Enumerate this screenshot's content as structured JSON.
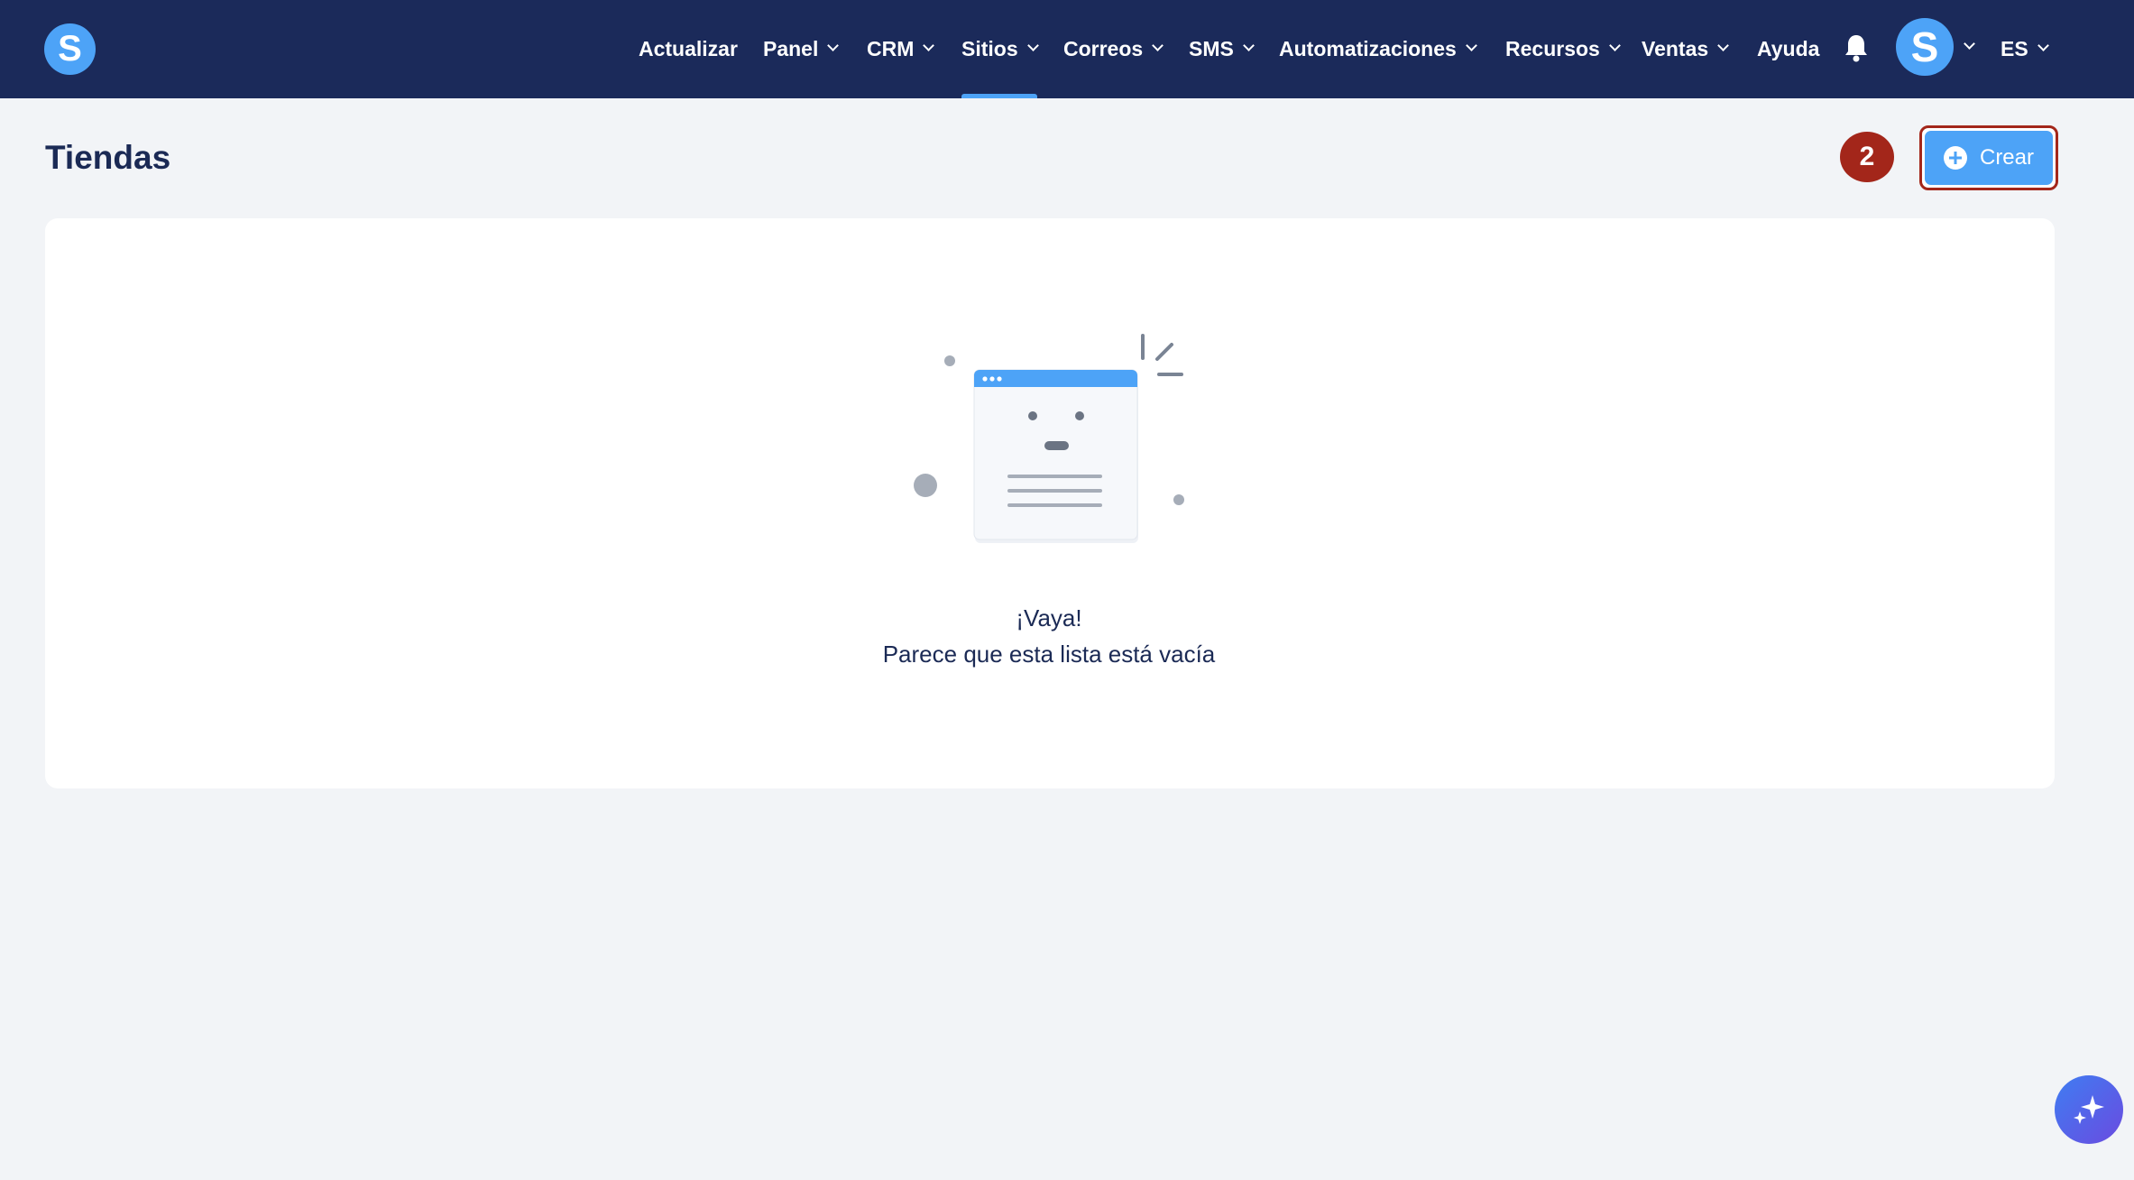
{
  "app": {
    "logo_letter": "S"
  },
  "nav": {
    "items": [
      {
        "label": "Actualizar"
      },
      {
        "label": "Panel"
      },
      {
        "label": "CRM"
      },
      {
        "label": "Sitios"
      },
      {
        "label": "Correos"
      },
      {
        "label": "SMS"
      },
      {
        "label": "Automatizaciones"
      },
      {
        "label": "Recursos"
      },
      {
        "label": "Ventas"
      },
      {
        "label": "Ayuda"
      }
    ],
    "active": "Sitios"
  },
  "user": {
    "avatar_letter": "S",
    "language": "ES"
  },
  "page": {
    "title": "Tiendas",
    "step_badge": "2",
    "create_label": "Crear"
  },
  "empty_state": {
    "title": "¡Vaya!",
    "subtitle": "Parece que esta lista está vacía"
  },
  "colors": {
    "topbar": "#1b2a5a",
    "accent": "#4da3f7",
    "badge": "#a3261a",
    "background": "#f2f4f7"
  }
}
